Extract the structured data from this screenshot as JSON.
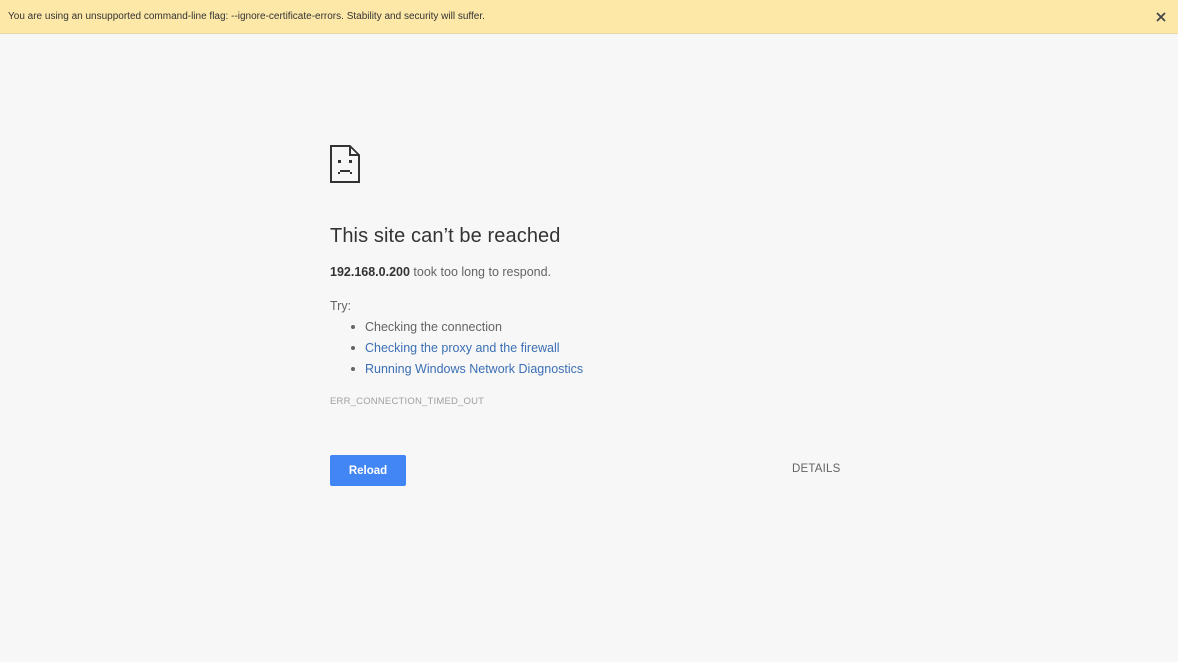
{
  "infobar": {
    "message": "You are using an unsupported command-line flag: --ignore-certificate-errors. Stability and security will suffer.",
    "close_icon": "close-icon"
  },
  "error": {
    "icon": "sad-page-icon",
    "title": "This site can’t be reached",
    "host": "192.168.0.200",
    "summary_suffix": " took too long to respond.",
    "try_label": "Try:",
    "suggestions": [
      {
        "label": "Checking the connection",
        "link": false
      },
      {
        "label": "Checking the proxy and the firewall",
        "link": true
      },
      {
        "label": "Running Windows Network Diagnostics",
        "link": true
      }
    ],
    "code": "ERR_CONNECTION_TIMED_OUT"
  },
  "buttons": {
    "reload_label": "Reload",
    "details_label": "DETAILS"
  },
  "colors": {
    "infobar_bg": "#fde8a8",
    "page_bg": "#f7f7f7",
    "button_blue": "#4285f4",
    "link_blue": "#3b6fb6"
  }
}
